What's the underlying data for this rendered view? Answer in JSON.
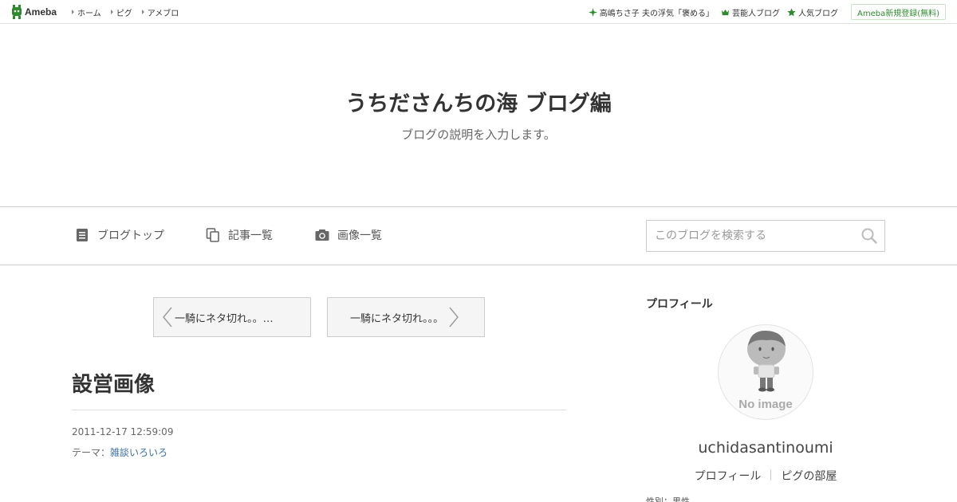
{
  "topbar": {
    "logo": "Ameba",
    "nav": [
      "ホーム",
      "ピグ",
      "アメブロ"
    ],
    "right": [
      {
        "label": "高嶋ちさ子 夫の浮気「褒める」",
        "icon": "sparkle-icon"
      },
      {
        "label": "芸能人ブログ",
        "icon": "crown-icon"
      },
      {
        "label": "人気ブログ",
        "icon": "star-icon"
      }
    ],
    "signup": "Ameba新規登録(無料)"
  },
  "header": {
    "title": "うちださんちの海 ブログ編",
    "description": "ブログの説明を入力します。"
  },
  "nav": {
    "blog_top": "ブログトップ",
    "entries": "記事一覧",
    "images": "画像一覧",
    "search_placeholder": "このブログを検索する"
  },
  "pager": {
    "prev": "一騎にネタ切れ。。…",
    "next": "一騎にネタ切れ。。。"
  },
  "entry": {
    "title": "設営画像",
    "date": "2011-12-17 12:59:09",
    "theme_label": "テーマ：",
    "theme": "雑談いろいろ"
  },
  "sidebar": {
    "heading": "プロフィール",
    "avatar_text": "No image",
    "username": "uchidasantinoumi",
    "profile_link": "プロフィール",
    "pigg_link": "ピグの部屋",
    "cut_off": "性別：男性"
  },
  "colors": {
    "ameba_green": "#2d8a2d",
    "link_blue": "#3a6ea5",
    "border": "#cccccc"
  }
}
